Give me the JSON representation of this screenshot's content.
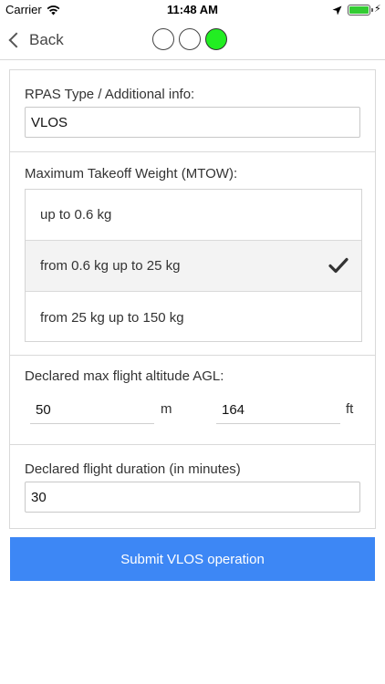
{
  "status_bar": {
    "carrier": "Carrier",
    "time": "11:48 AM",
    "battery_color": "#33cc33"
  },
  "nav": {
    "back_label": "Back",
    "steps": [
      {
        "state": "inactive"
      },
      {
        "state": "inactive"
      },
      {
        "state": "active",
        "color": "#22ee22"
      }
    ]
  },
  "form": {
    "rpas": {
      "label": "RPAS Type / Additional info:",
      "value": "VLOS"
    },
    "mtow": {
      "label": "Maximum Takeoff Weight (MTOW):",
      "options": [
        {
          "label": "up to 0.6 kg",
          "selected": false
        },
        {
          "label": "from 0.6 kg up to 25 kg",
          "selected": true
        },
        {
          "label": "from 25 kg up to 150 kg",
          "selected": false
        }
      ]
    },
    "altitude": {
      "label": "Declared max flight altitude AGL:",
      "meters_value": "50",
      "meters_unit": "m",
      "feet_value": "164",
      "feet_unit": "ft"
    },
    "duration": {
      "label": "Declared flight duration (in minutes)",
      "value": "30"
    }
  },
  "submit": {
    "label": "Submit VLOS operation",
    "color": "#3d87f5"
  }
}
